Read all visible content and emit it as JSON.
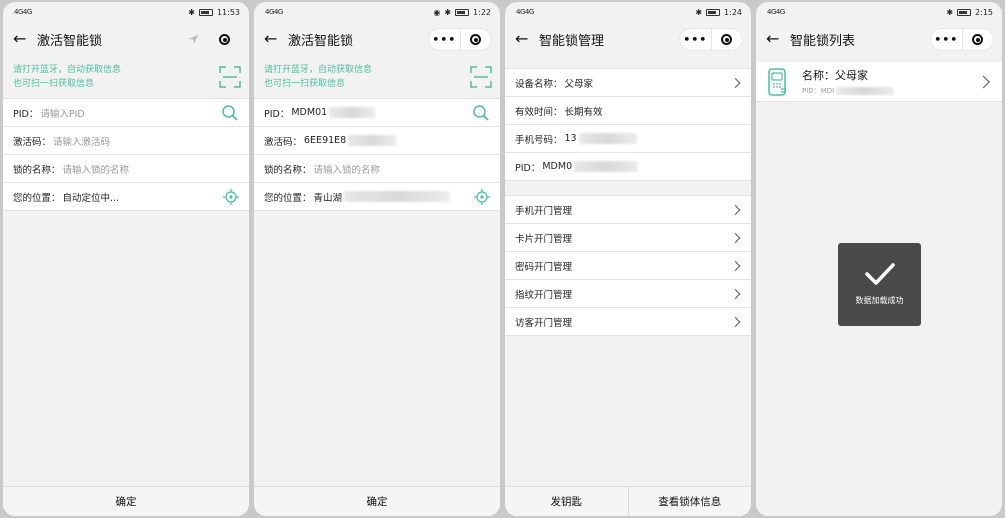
{
  "screen1": {
    "status": {
      "signal": "4G4G",
      "time": "11:53"
    },
    "title": "激活智能锁",
    "hint": {
      "line1": "请打开蓝牙，自动获取信息",
      "line2": "也可扫一扫获取信息"
    },
    "fields": [
      {
        "label": "PID：",
        "placeholder": "请输入PID"
      },
      {
        "label": "激活码：",
        "placeholder": "请输入激活码"
      },
      {
        "label": "锁的名称：",
        "placeholder": "请输入锁的名称"
      },
      {
        "label": "您的位置：",
        "value": "自动定位中..."
      }
    ],
    "confirm": "确定"
  },
  "screen2": {
    "status": {
      "signal": "4G4G",
      "time": "1:22"
    },
    "title": "激活智能锁",
    "hint": {
      "line1": "请打开蓝牙，自动获取信息",
      "line2": "也可扫一扫获取信息"
    },
    "fields": [
      {
        "label": "PID：",
        "value": "MDM01"
      },
      {
        "label": "激活码：",
        "value": "6EE91E8"
      },
      {
        "label": "锁的名称：",
        "placeholder": "请输入锁的名称"
      },
      {
        "label": "您的位置：",
        "value": "青山湖"
      }
    ],
    "confirm": "确定"
  },
  "screen3": {
    "status": {
      "signal": "4G4G",
      "time": "1:24"
    },
    "title": "智能锁管理",
    "info": [
      {
        "label": "设备名称：",
        "value": "父母家"
      },
      {
        "label": "有效时间：",
        "value": "长期有效"
      },
      {
        "label": "手机号码：",
        "value": "13"
      },
      {
        "label": "PID：",
        "value": "MDM0"
      }
    ],
    "menu": [
      "手机开门管理",
      "卡片开门管理",
      "密码开门管理",
      "指纹开门管理",
      "访客开门管理"
    ],
    "buttons": {
      "left": "发钥匙",
      "right": "查看锁体信息"
    }
  },
  "screen4": {
    "status": {
      "signal": "4G4G",
      "time": "2:15"
    },
    "title": "智能锁列表",
    "lock": {
      "name_label": "名称：",
      "name": "父母家",
      "pid_label": "PID：",
      "pid": "MDI"
    },
    "toast": "数据加载成功"
  },
  "colors": {
    "accent": "#4cbf9b",
    "toast_bg": "#3c3c3c"
  }
}
